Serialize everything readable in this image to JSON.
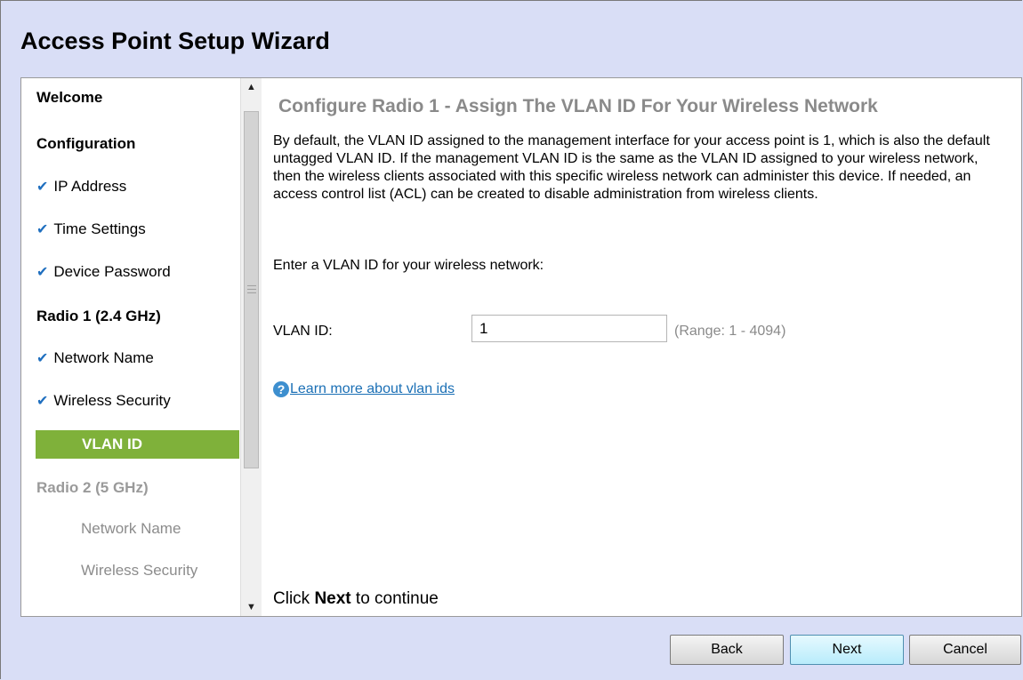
{
  "window": {
    "title": "Access Point Setup Wizard"
  },
  "nav": {
    "welcome": "Welcome",
    "configuration": "Configuration",
    "ip_address": "IP Address",
    "time_settings": "Time Settings",
    "device_password": "Device Password",
    "radio1": "Radio 1 (2.4 GHz)",
    "radio1_network_name": "Network Name",
    "radio1_wireless_security": "Wireless Security",
    "radio1_vlan_id": "VLAN ID",
    "radio2": "Radio 2 (5 GHz)",
    "radio2_network_name": "Network Name",
    "radio2_wireless_security": "Wireless Security",
    "check_glyph": "✔"
  },
  "content": {
    "title": "Configure Radio 1 - Assign The VLAN ID For Your Wireless Network",
    "description": "By default, the VLAN ID assigned to the management interface for your access point is 1, which is also the default untagged VLAN ID. If the management VLAN ID is the same as the VLAN ID assigned to your wireless network, then the wireless clients associated with this specific wireless network can administer this device. If needed, an access control list (ACL) can be created to disable administration from wireless clients.",
    "prompt": "Enter a VLAN ID for your wireless network:",
    "vlan_label": "VLAN ID:",
    "vlan_value": "1",
    "range_hint": "(Range: 1 - 4094)",
    "help_glyph": "?",
    "help_link": "Learn more about vlan ids",
    "continue_prefix": "Click ",
    "continue_bold": "Next",
    "continue_suffix": " to continue"
  },
  "buttons": {
    "back": "Back",
    "next": "Next",
    "cancel": "Cancel"
  },
  "colors": {
    "accent": "#7fb13a",
    "background": "#d9def6",
    "link": "#1a6fb5",
    "check": "#1f6fbf"
  }
}
